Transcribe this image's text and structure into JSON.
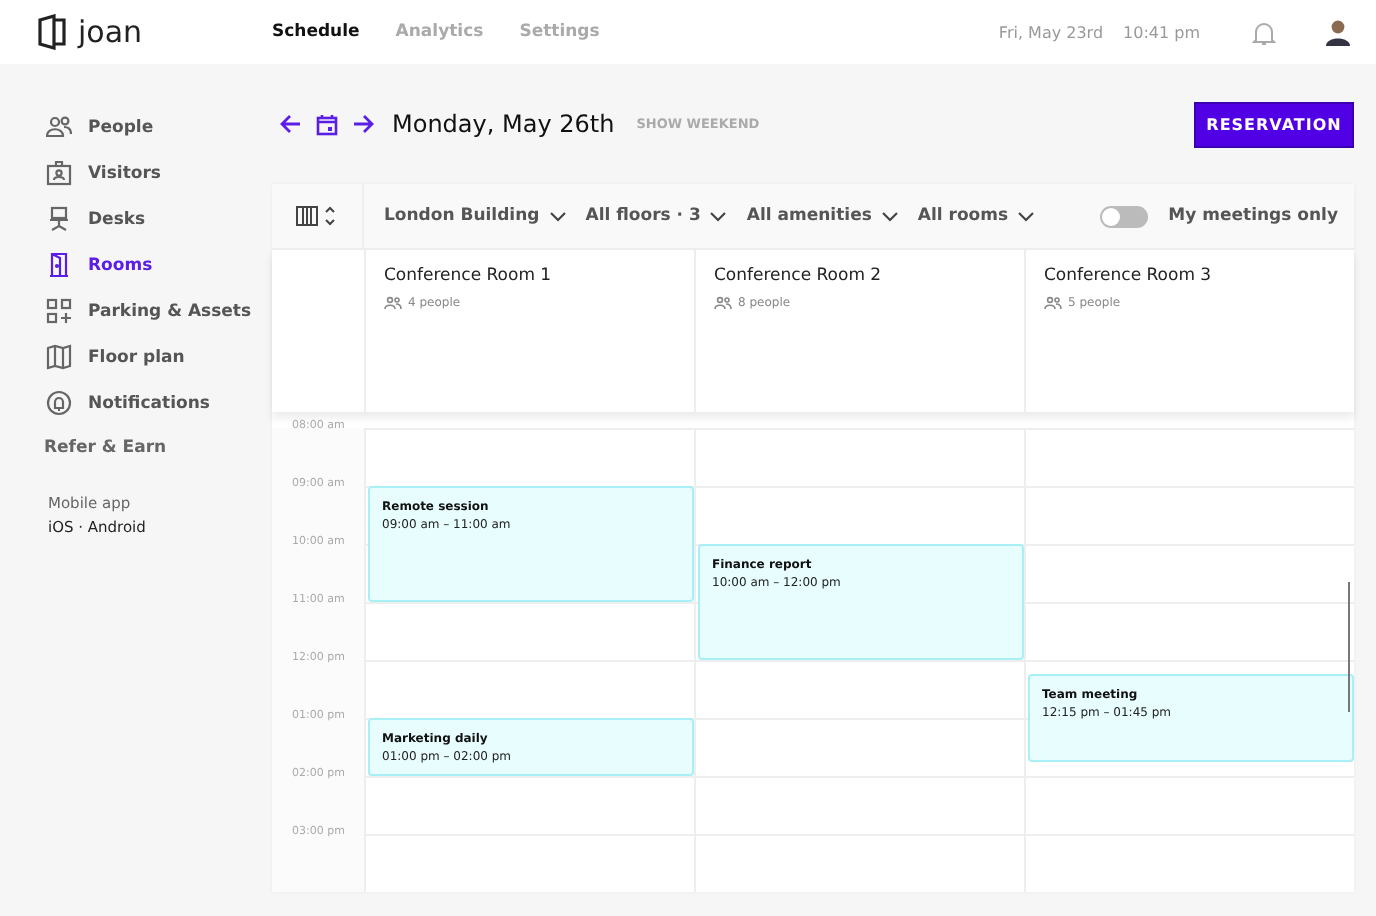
{
  "header": {
    "logo": "joan",
    "nav": [
      {
        "label": "Schedule",
        "selected": true
      },
      {
        "label": "Analytics",
        "selected": false
      },
      {
        "label": "Settings",
        "selected": false
      }
    ],
    "date": "Fri, May 23rd",
    "time": "10:41 pm"
  },
  "sidebar": {
    "items": [
      {
        "label": "People",
        "selected": false
      },
      {
        "label": "Visitors",
        "selected": false
      },
      {
        "label": "Desks",
        "selected": false
      },
      {
        "label": "Rooms",
        "selected": true
      },
      {
        "label": "Parking & Assets",
        "selected": false
      },
      {
        "label": "Floor plan",
        "selected": false
      },
      {
        "label": "Notifications",
        "selected": false
      }
    ],
    "refer": "Refer & Earn",
    "mobile_label": "Mobile app",
    "mobile_links": "iOS · Android"
  },
  "topbar": {
    "date": "Monday, May 26th",
    "show_weekend": "SHOW WEEKEND",
    "reservation": "RESERVATION"
  },
  "filters": [
    {
      "label": "London Building"
    },
    {
      "label": "All floors · 3"
    },
    {
      "label": "All amenities"
    },
    {
      "label": "All rooms"
    }
  ],
  "my_meetings": {
    "label": "My meetings only",
    "on": false
  },
  "hours": [
    "08:00 am",
    "09:00 am",
    "10:00 am",
    "11:00 am",
    "12:00 pm",
    "01:00 pm",
    "02:00 pm",
    "03:00 pm"
  ],
  "rooms": [
    {
      "name": "Conference Room 1",
      "capacity": "4 people",
      "events": [
        {
          "title": "Remote session",
          "time": "09:00 am – 11:00 am"
        },
        {
          "title": "Marketing daily",
          "time": "01:00 pm – 02:00 pm"
        }
      ]
    },
    {
      "name": "Conference Room 2",
      "capacity": "8 people",
      "events": [
        {
          "title": "Finance report",
          "time": "10:00 am – 12:00 pm"
        }
      ]
    },
    {
      "name": "Conference Room 3",
      "capacity": "5 people",
      "events": [
        {
          "title": "Team meeting",
          "time": "12:15 pm – 01:45 pm"
        }
      ]
    }
  ]
}
